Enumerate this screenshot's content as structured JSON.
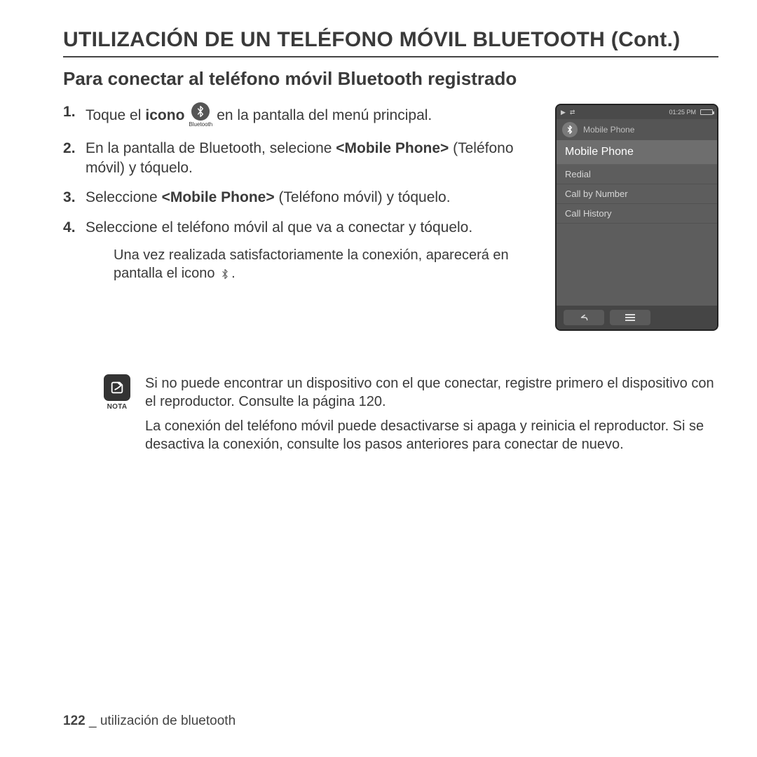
{
  "title": "UTILIZACIÓN DE UN TELÉFONO MÓVIL BLUETOOTH (Cont.)",
  "subtitle": "Para conectar al teléfono móvil Bluetooth registrado",
  "steps": {
    "s1a": "Toque el ",
    "s1b_bold": "icono",
    "s1c": " en la pantalla del menú principal.",
    "bt_icon_label": "Bluetooth",
    "s2a": "En la pantalla de Bluetooth, selecione ",
    "s2b_bold": "<Mobile Phone>",
    "s2c": " (Teléfono móvil) y tóquelo.",
    "s3a": "Seleccione ",
    "s3b_bold": "<Mobile Phone>",
    "s3c": " (Teléfono móvil) y tóquelo.",
    "s4": "Seleccione el teléfono móvil al que va a conectar y tóquelo.",
    "after_a": "Una vez realizada satisfactoriamente la conexión, aparecerá en pantalla el icono ",
    "after_b": "."
  },
  "phone": {
    "status_time": "01:25 PM",
    "header": "Mobile Phone",
    "items": [
      {
        "label": "Mobile Phone",
        "selected": true
      },
      {
        "label": "Redial",
        "selected": false
      },
      {
        "label": "Call by Number",
        "selected": false
      },
      {
        "label": "Call History",
        "selected": false
      }
    ]
  },
  "nota": {
    "label": "NOTA",
    "p1": "Si no puede encontrar un dispositivo con el que conectar, registre primero el dispositivo con el reproductor. Consulte la página 120.",
    "p2": "La conexión del teléfono móvil puede desactivarse si apaga y reinicia el reproductor. Si se desactiva la conexión, consulte los pasos anteriores para conectar de nuevo."
  },
  "footer": {
    "page": "122",
    "sep": " _ ",
    "section": "utilización de bluetooth"
  }
}
